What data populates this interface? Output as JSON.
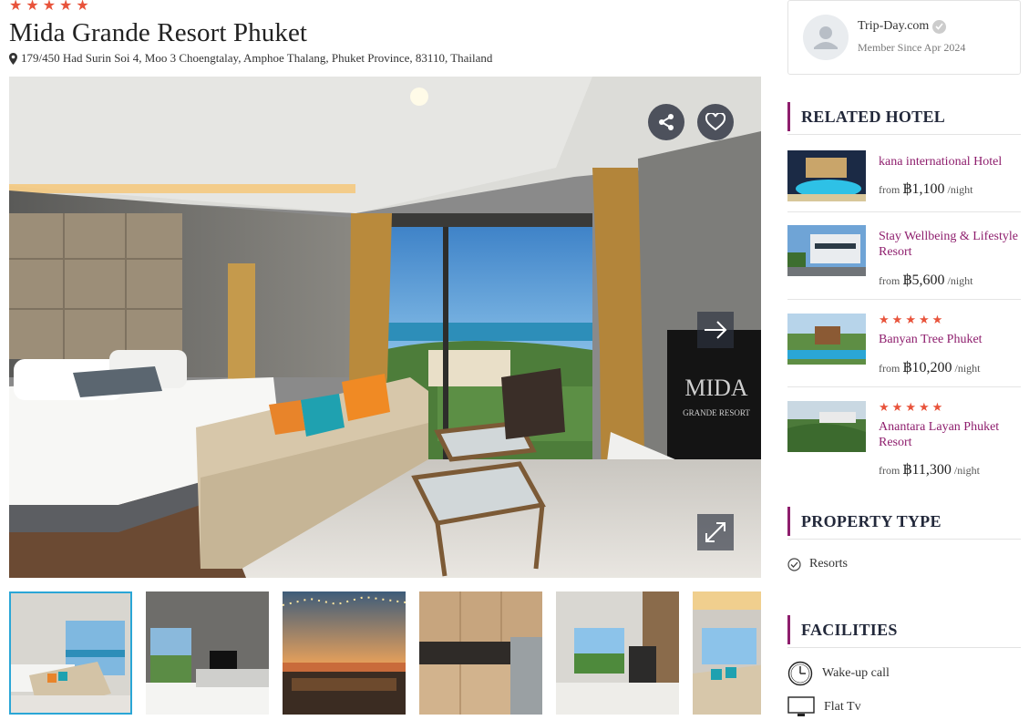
{
  "hotel": {
    "stars": 5,
    "name": "Mida Grande Resort Phuket",
    "address": "179/450 Had Surin Soi 4, Moo 3 Choengtalay, Amphoe Thalang, Phuket Province, 83110, Thailand"
  },
  "gallery": {
    "icons": [
      "share-icon",
      "heart-icon",
      "arrow-right-icon",
      "expand-icon"
    ],
    "tv_brand_text": "MIDA",
    "tv_sub_text": "GRANDE RESORT",
    "thumbnail_count": 6,
    "active_thumbnail": 1
  },
  "member": {
    "name": "Trip-Day.com",
    "since": "Member Since Apr 2024"
  },
  "sections": {
    "related": "RELATED HOTEL",
    "property_type": "PROPERTY TYPE",
    "facilities": "FACILITIES"
  },
  "related_hotels": [
    {
      "name": "kana international Hotel",
      "stars": 0,
      "from": "from",
      "price": "฿1,100",
      "unit": "/night"
    },
    {
      "name": "Stay Wellbeing & Lifestyle Resort",
      "stars": 0,
      "from": "from",
      "price": "฿5,600",
      "unit": "/night"
    },
    {
      "name": "Banyan Tree Phuket",
      "stars": 5,
      "from": "from",
      "price": "฿10,200",
      "unit": "/night"
    },
    {
      "name": "Anantara Layan Phuket Resort",
      "stars": 5,
      "from": "from",
      "price": "฿11,300",
      "unit": "/night"
    }
  ],
  "property_type": {
    "label": "Resorts",
    "icon": "check-circle-icon"
  },
  "facilities": [
    {
      "label": "Wake-up call",
      "icon": "clock-icon"
    },
    {
      "label": "Flat Tv",
      "icon": "tv-icon"
    }
  ],
  "colors": {
    "accent": "#8e1e6d",
    "star": "#e8533b",
    "active_thumb_border": "#2aa6d6",
    "heading": "#22283a"
  }
}
